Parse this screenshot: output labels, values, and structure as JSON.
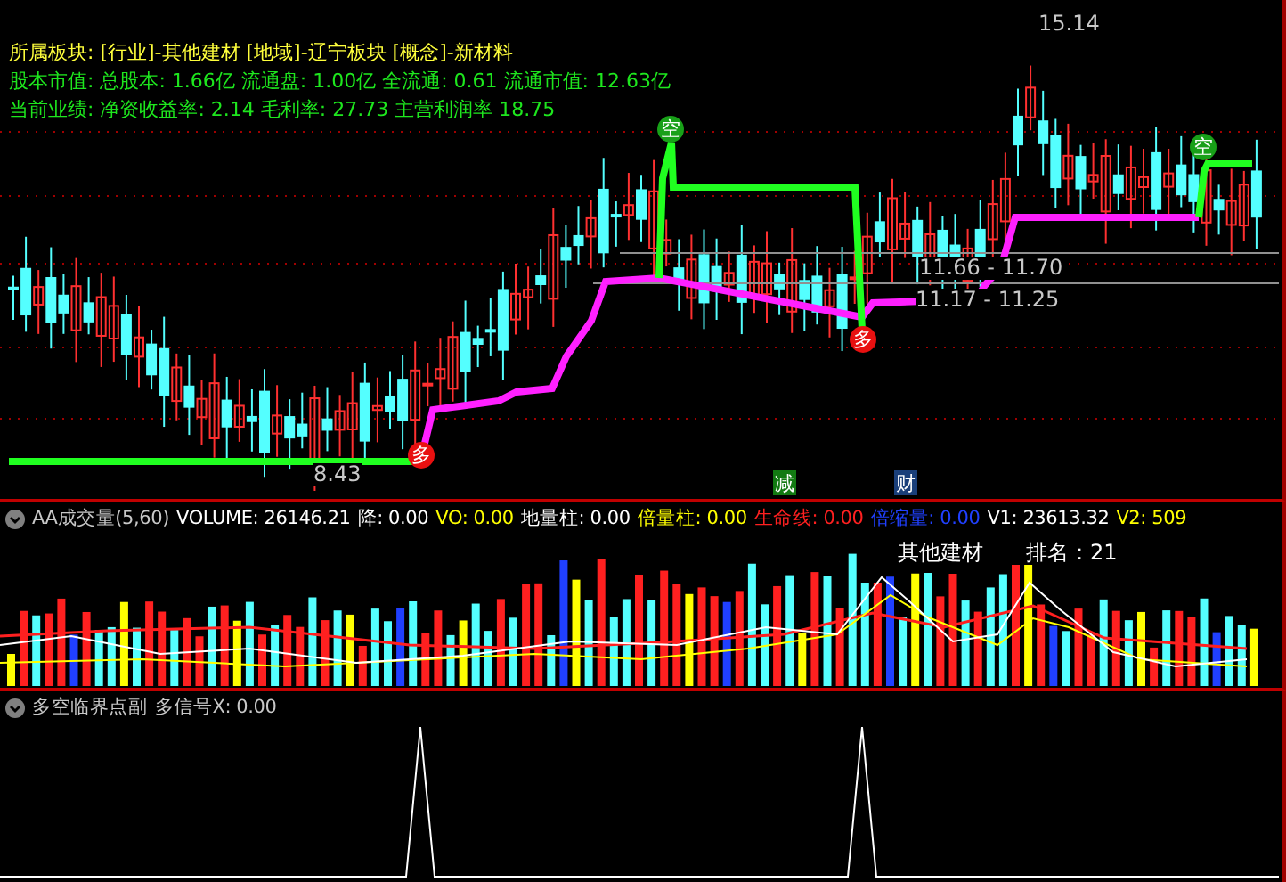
{
  "main_panel": {
    "info_lines": [
      {
        "kind": "sector",
        "text": "所属板块: [行业]-其他建材 [地域]-辽宁板块 [概念]-新材料"
      },
      {
        "kind": "metric",
        "text": "股本市值: 总股本: 1.66亿 流通盘: 1.00亿 全流通: 0.61 流通市值: 12.63亿"
      },
      {
        "kind": "metric",
        "text": "当前业绩: 净资收益率: 2.14 毛利率: 27.73 主营利润率 18.75"
      }
    ],
    "price_labels": [
      {
        "text": "15.14"
      },
      {
        "text": "8.43"
      },
      {
        "text": "11.66 - 11.70"
      },
      {
        "text": "11.17 - 11.25"
      }
    ],
    "signals": [
      {
        "kind": "long",
        "text": "多"
      },
      {
        "kind": "short",
        "text": "空"
      },
      {
        "kind": "long",
        "text": "多"
      },
      {
        "kind": "short",
        "text": "空"
      }
    ],
    "events": [
      {
        "text": "减",
        "color": "#127a12"
      },
      {
        "text": "财",
        "color": "#1a3f7a"
      }
    ]
  },
  "volume_panel": {
    "title": "AA成交量(5,60)",
    "legend": [
      {
        "text": "VOLUME: 26146.21",
        "color": "#ffffff"
      },
      {
        "text": "降: 0.00",
        "color": "#ffffff"
      },
      {
        "text": "VO: 0.00",
        "color": "#ffff00"
      },
      {
        "text": "地量柱: 0.00",
        "color": "#ffffff"
      },
      {
        "text": "倍量柱: 0.00",
        "color": "#ffff00"
      },
      {
        "text": "生命线: 0.00",
        "color": "#ff2020"
      },
      {
        "text": "倍缩量: 0.00",
        "color": "#2040ff"
      },
      {
        "text": "V1: 23613.32",
        "color": "#ffffff"
      },
      {
        "text": "V2: 509",
        "color": "#ffff00"
      }
    ],
    "sector_name": "其他建材",
    "rank": "排名：21"
  },
  "signal_panel": {
    "title": "多空临界点副",
    "legend": "多信号X: 0.00"
  }
}
